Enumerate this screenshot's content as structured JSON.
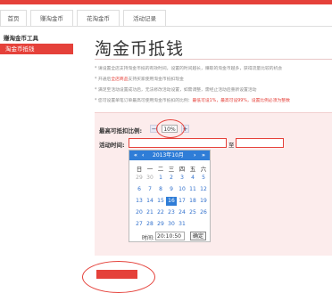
{
  "tabs": [
    {
      "label": "首页"
    },
    {
      "label": "赚淘金币"
    },
    {
      "label": "花淘金币"
    },
    {
      "label": "活动记录"
    }
  ],
  "sidebar": {
    "heading": "赚淘金币工具",
    "items": [
      {
        "label": "淘金币抵钱"
      }
    ]
  },
  "page": {
    "title": "淘金币抵钱",
    "notes": [
      {
        "text": "* 请设置全店支持淘金币抵的有效时间，设置的时间越长，赚取的淘金币越多，获得流量比较的机会"
      },
      {
        "text": "* 开通后全店商品支持买家使用淘金币抵扣现金",
        "red": "全店商品"
      },
      {
        "text": "* 满足至活动设置成功后，无法修改活动设置，如需调整，需经止活动后重新设置活动"
      },
      {
        "text": "* 您可设置单笔订单最高可使用淘金币抵扣的比例：最低可设1%，最高可设99%，设置比例必须为整数",
        "red": "最低可设1%，最高可设99%，设置比例必须为整数"
      }
    ]
  },
  "form": {
    "max_ratio_label": "最高可抵扣比例:",
    "minus": "−",
    "plus": "+",
    "ratio_value": "10%",
    "activity_time_label": "活动时间:",
    "to_label": "至"
  },
  "calendar": {
    "prev_year": "«",
    "prev_month": "‹",
    "title": "2013年10月",
    "next_month": "›",
    "next_year": "»",
    "weekdays": [
      "日",
      "一",
      "二",
      "三",
      "四",
      "五",
      "六"
    ],
    "weeks": [
      [
        "29",
        "30",
        "1",
        "2",
        "3",
        "4",
        "5"
      ],
      [
        "6",
        "7",
        "8",
        "9",
        "10",
        "11",
        "12"
      ],
      [
        "13",
        "14",
        "15",
        "16",
        "17",
        "18",
        "19"
      ],
      [
        "20",
        "21",
        "22",
        "23",
        "24",
        "25",
        "26"
      ],
      [
        "27",
        "28",
        "29",
        "30",
        "31",
        "",
        ""
      ]
    ],
    "selected_day": "16",
    "time_label": "时间:",
    "time_value": "20:10:50",
    "confirm": "确定"
  },
  "colors": {
    "accent": "#e5413a",
    "calendar_header": "#2f7dd7",
    "panel_bg": "#fcecec"
  }
}
